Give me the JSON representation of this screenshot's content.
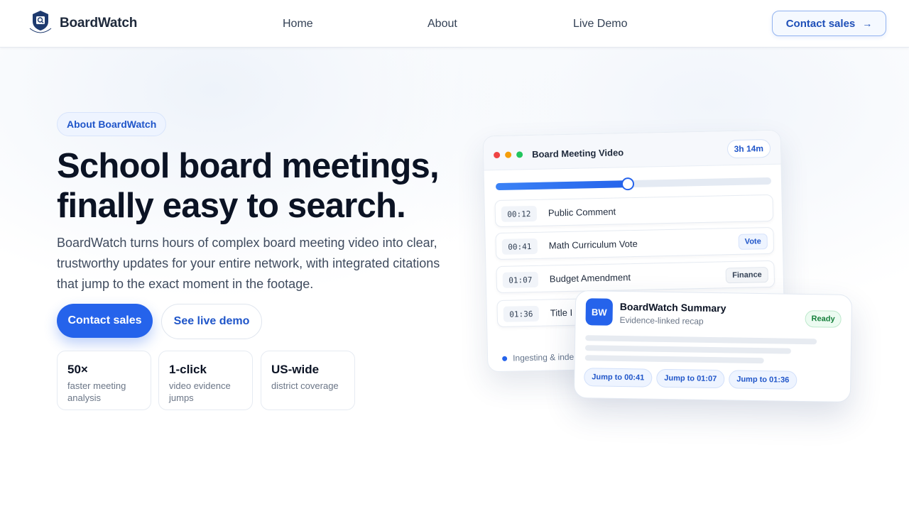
{
  "header": {
    "brand": "BoardWatch",
    "logo_text": "BOARDWATCH",
    "nav": [
      "Home",
      "About",
      "Live Demo"
    ],
    "cta_label": "Contact sales",
    "cta_icon": "arrow-right-icon"
  },
  "hero": {
    "pill": "About BoardWatch",
    "title_line1": "School board meetings,",
    "title_line2": "finally easy to search.",
    "lead": "BoardWatch turns hours of complex board meeting video into clear, trustworthy updates for your entire network, with integrated citations that jump to the exact moment in the footage.",
    "primary_cta": "Contact sales",
    "secondary_cta": "See live demo",
    "stats": [
      {
        "value": "50×",
        "label": "faster meeting analysis"
      },
      {
        "value": "1-click",
        "label": "video evidence jumps"
      },
      {
        "value": "US-wide",
        "label": "district coverage"
      }
    ]
  },
  "video_card": {
    "title": "Board Meeting Video",
    "duration": "3h 14m",
    "progress": 0.48,
    "rows": [
      {
        "ts": "00:12",
        "label": "Public Comment",
        "tag": ""
      },
      {
        "ts": "00:41",
        "label": "Math Curriculum Vote",
        "tag": "Vote"
      },
      {
        "ts": "01:07",
        "label": "Budget Amendment",
        "tag": "Finance"
      },
      {
        "ts": "01:36",
        "label": "Title I",
        "tag": ""
      }
    ],
    "status": "Ingesting & inde"
  },
  "summary_card": {
    "avatar": "BW",
    "title": "BoardWatch Summary",
    "subtitle": "Evidence-linked recap",
    "badge": "Ready",
    "jumps": [
      "Jump to 00:41",
      "Jump to 01:07",
      "Jump to 01:36"
    ]
  },
  "colors": {
    "accent": "#2563eb",
    "text": "#0b1324",
    "muted": "#6b7687",
    "ready": "#16803c"
  }
}
